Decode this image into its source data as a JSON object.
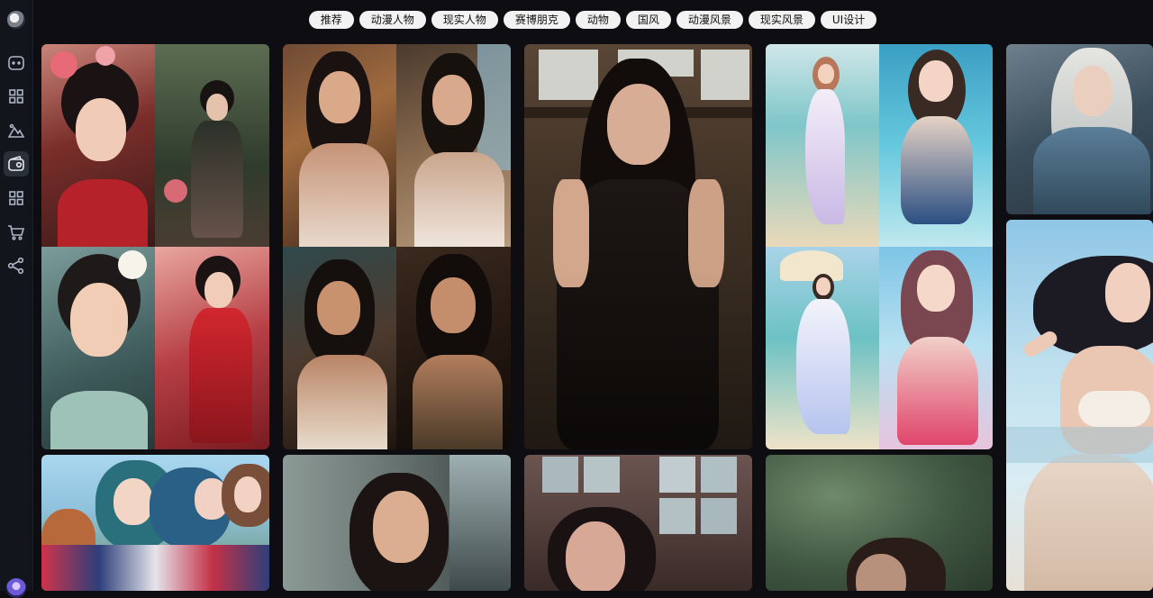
{
  "app": {
    "logo_icon": "app-logo-icon"
  },
  "sidebar": {
    "items": [
      {
        "name": "chat",
        "icon": "chat-icon"
      },
      {
        "name": "apps",
        "icon": "grid-icon"
      },
      {
        "name": "landscape",
        "icon": "mountain-icon"
      },
      {
        "name": "gallery",
        "icon": "wallet-icon",
        "active": true
      },
      {
        "name": "more-apps",
        "icon": "grid-icon"
      },
      {
        "name": "shop",
        "icon": "cart-icon"
      },
      {
        "name": "share",
        "icon": "share-icon"
      }
    ],
    "active_color": "#2a2f3a"
  },
  "tabs": [
    {
      "label": "推荐"
    },
    {
      "label": "动漫人物"
    },
    {
      "label": "现实人物"
    },
    {
      "label": "赛博朋克"
    },
    {
      "label": "动物"
    },
    {
      "label": "国风"
    },
    {
      "label": "动漫风景"
    },
    {
      "label": "现实风景"
    },
    {
      "label": "UI设计"
    }
  ],
  "gallery": {
    "cards": [
      {
        "id": "card-1",
        "subject": "chinese-style-women-collage"
      },
      {
        "id": "card-2",
        "subject": "realistic-women-collage"
      },
      {
        "id": "card-3",
        "subject": "realistic-woman-black-dress"
      },
      {
        "id": "card-4",
        "subject": "anime-beach-women-collage"
      },
      {
        "id": "card-5",
        "subject": "anime-man-long-hair"
      },
      {
        "id": "card-6",
        "subject": "anime-girl-beach-splash"
      },
      {
        "id": "card-7",
        "subject": "anime-girls-group"
      },
      {
        "id": "card-8",
        "subject": "woman-by-window"
      },
      {
        "id": "card-9",
        "subject": "woman-window-frame"
      },
      {
        "id": "card-10",
        "subject": "woman-outdoor-blur"
      }
    ]
  }
}
